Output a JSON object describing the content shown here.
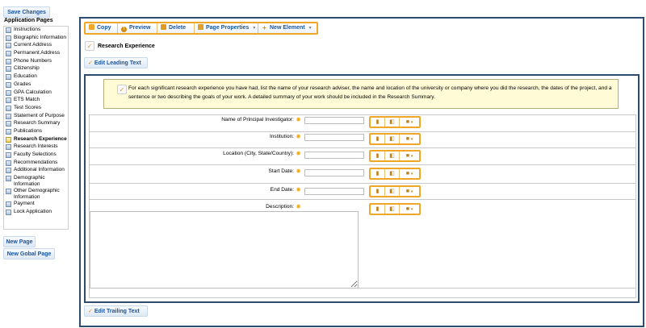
{
  "sidebar": {
    "save_label": "Save Changes",
    "title": "Application Pages",
    "pages": [
      {
        "label": "Instructions"
      },
      {
        "label": "Biographic Information"
      },
      {
        "label": "Current Address"
      },
      {
        "label": "Permanent Address"
      },
      {
        "label": "Phone Numbers"
      },
      {
        "label": "Citizenship"
      },
      {
        "label": "Education"
      },
      {
        "label": "Grades"
      },
      {
        "label": "GPA Calculation"
      },
      {
        "label": "ETS Match"
      },
      {
        "label": "Test Scores"
      },
      {
        "label": "Statement of Purpose"
      },
      {
        "label": "Research Summary"
      },
      {
        "label": "Publications"
      },
      {
        "label": "Research Experience",
        "active": true
      },
      {
        "label": "Research Interests"
      },
      {
        "label": "Faculty Selections"
      },
      {
        "label": "Recommendations"
      },
      {
        "label": "Additional Information"
      },
      {
        "label": "Demographic Information",
        "multi": true
      },
      {
        "label": "Other Demographic Information",
        "multi": true
      },
      {
        "label": "Payment"
      },
      {
        "label": "Lock Application"
      }
    ],
    "new_page_label": "New Page",
    "new_global_label": "New Gobal Page"
  },
  "toolbar": {
    "copy": "Copy",
    "preview": "Preview",
    "delete": "Delete",
    "page_properties": "Page Properties",
    "new_element": "New Element"
  },
  "page_title": "Research Experience",
  "edit_leading": "Edit Leading Text",
  "edit_trailing": "Edit Trailing Text",
  "instruction": "For each significant research experience you have had, list the name of your research adviser, the name and location of the university or company where you did the research, the dates of the project, and a sentence or two describing the goals of your work. A detailed summary of your work should be included in the Research Summary.",
  "fields": [
    {
      "label": "Name of Principal Investigator:"
    },
    {
      "label": "Institution:"
    },
    {
      "label": "Location (City, State/Country):"
    },
    {
      "label": "Start Date:"
    },
    {
      "label": "End Date:"
    },
    {
      "label": "Description:"
    }
  ],
  "colors": {
    "accent": "#f0a728",
    "frame": "#2d4c6e",
    "link": "#1a55a0",
    "note_bg": "#fffbd6"
  }
}
